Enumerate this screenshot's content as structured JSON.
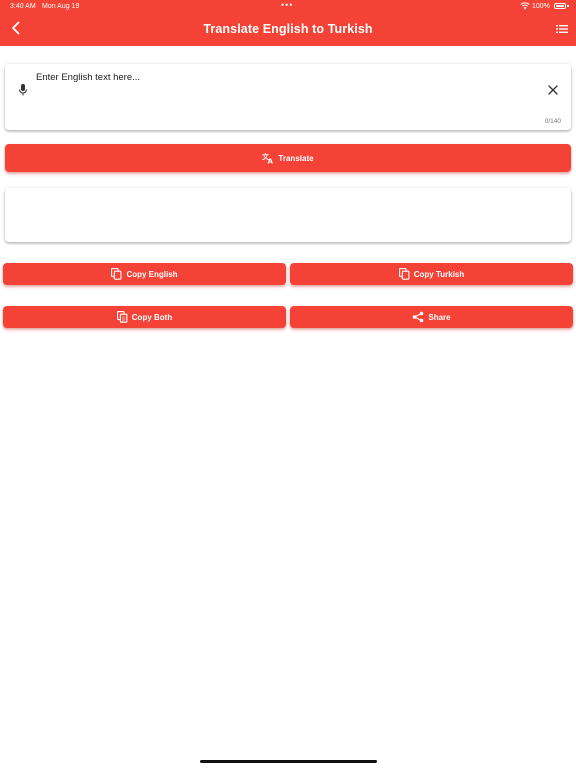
{
  "status_bar": {
    "time": "3:40 AM",
    "date": "Mon Aug 19",
    "dots": "•••",
    "battery": "100%"
  },
  "app_bar": {
    "title": "Translate English to Turkish",
    "back_icon": "back-icon",
    "menu_icon": "list-icon",
    "color": "#f44336"
  },
  "input": {
    "placeholder": "Enter English text here...",
    "value": "",
    "counter": "0/140",
    "mic_icon": "mic-icon",
    "clear_icon": "close-icon"
  },
  "buttons": {
    "translate": "Translate",
    "copy_english": "Copy English",
    "copy_turkish": "Copy Turkish",
    "copy_both": "Copy Both",
    "share": "Share"
  },
  "output": {
    "value": ""
  }
}
